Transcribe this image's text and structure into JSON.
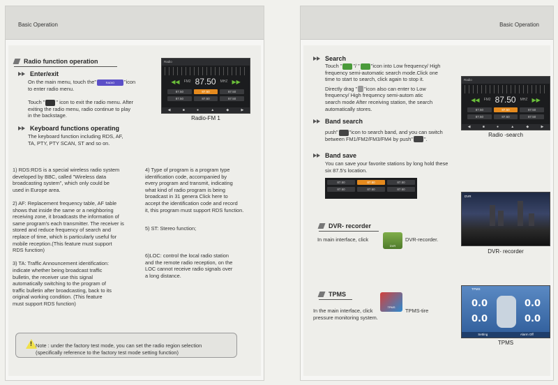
{
  "left": {
    "header": "Basic Operation",
    "section_title": "Radio function operation",
    "enter_exit": {
      "title": "Enter/exit",
      "line1a": "On the main menu, touch the\"",
      "line1b": "\"icon",
      "line2": "to enter radio menu.",
      "icon_label": "RADIO",
      "touch_a": "Touch \"",
      "touch_b": "\" icon to exit the radio menu. After",
      "touch2": "exiting the radio menu, radio continue to play",
      "touch3": "in the backstage."
    },
    "keyboard": {
      "title": "Keyboard functions operating",
      "line1": "The keyboard function including RDS, AF,",
      "line2": "TA, PTY, PTY SCAN, ST and so on."
    },
    "col1": [
      "1) RDS:RDS is a special wireless radio system",
      " developed by BBC, called \"Wireless data",
      " broadcasting system\", which only could be",
      "  used  in Europe area.",
      "",
      "2) AF: Replacement frequency table, AF table",
      " shows that inside the same or a neighboring",
      " receiving zone, it broadcasts the information of",
      " same program's each transmitter. The receiver is",
      " stored and reduce frequency of search and",
      " replace of time, which is particularly useful for",
      " mobile reception.(This feature must support",
      " RDS function)",
      "",
      "3) TA: Traffic Announcement identification:",
      " indicate whether being broadcast traffic",
      " bulletin, the receiver use this signal",
      " automatically switching to the program of",
      " traffic bulletin after broadcasting, back to its",
      " original working condition. (This feature",
      " must support RDS function)"
    ],
    "col2a": [
      "4) Type of program is a program type",
      "identification code, accompanied by",
      "every program and transmit, indicating",
      "what kind of radio program is being",
      "broadcast in 31 genera Click here to",
      "accept the identification code and record",
      "it, this program must support RDS function."
    ],
    "col2b": "5) ST: Stereo function;",
    "col2c": [
      "6)LOC: control the local radio station",
      "and the remote radio reception, on the",
      "LOC cannot receive radio signals over",
      "a long distance."
    ],
    "note_line1": "Note : under the factory test mode, you can set the radio region selection",
    "note_line2": "(specifically reference to the factory test mode setting function)",
    "radio_caption": "Radio-FM 1"
  },
  "radio_ui": {
    "band": "FM2",
    "freq": "87.50",
    "unit": "MHZ",
    "presets": [
      "87.50",
      "87.50",
      "87.50",
      "87.50",
      "87.50",
      "87.50"
    ],
    "title": "Radio"
  },
  "right": {
    "header": "Basic Operation",
    "search": {
      "title": "Search",
      "l1a": "Touch \"",
      "l1b": "\"/ \"",
      "l1c": "\"icon into Low frequency/ High",
      "l2": "frequency semi-automatic search mode.Click one",
      "l3": "time to start to search, click again to stop it.",
      "l4a": "Directly drag \"",
      "l4b": "\"icon also can enter to Low",
      "l5": "frequency/ High frequency semi-autom atic",
      "l6": "search mode After receiving station, the search",
      "l7": "automatically stores."
    },
    "band": {
      "title": "Band search",
      "l1a": "push\"",
      "l1b": "\"icon to search band, and you can switch",
      "l2a": "between FM1/FM2/FM3/FM4 by push\"",
      "l2b": "\"."
    },
    "save": {
      "title": "Band save",
      "l1": "You can save your favorite stations by long hold these",
      "l2": "six 87.5's location."
    },
    "save_presets": [
      "87.50",
      "87.50",
      "87.50",
      "87.50",
      "87.50",
      "87.50"
    ],
    "radio_caption": "Radio -search",
    "dvr": {
      "title": "DVR- recorder",
      "text_a": "In main interface, click",
      "text_b": "DVR-recorder.",
      "caption": "DVR- recorder",
      "icon_label": "DVR",
      "screen_label": "DVR"
    },
    "tpms": {
      "title": "TPMS",
      "text_a": "In the main interface, click",
      "text_b": "TPMS-tire",
      "text_c": "pressure monitoring system.",
      "caption": "TPMS",
      "icon_label": "TPMS",
      "values": [
        "0.0",
        "0.0",
        "0.0",
        "0.0"
      ],
      "screen_title": "TPMS",
      "btn1": "Setting",
      "btn2": "Alarm Off"
    }
  }
}
